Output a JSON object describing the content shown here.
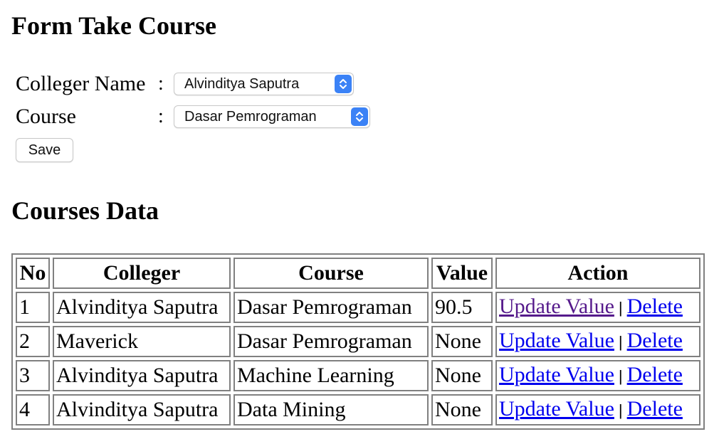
{
  "form": {
    "title": "Form Take Course",
    "colleger_label": "Colleger Name",
    "colleger_colon": ":",
    "colleger_value": "Alvinditya Saputra",
    "course_label": "Course",
    "course_colon": ":",
    "course_value": "Dasar Pemrograman",
    "save_label": "Save"
  },
  "courses": {
    "title": "Courses Data",
    "headers": [
      "No",
      "Colleger",
      "Course",
      "Value",
      "Action"
    ],
    "rows": [
      {
        "no": "1",
        "colleger": "Alvinditya Saputra",
        "course": "Dasar Pemrograman",
        "value": "90.5",
        "update": "Update Value",
        "sep": "|",
        "delete": "Delete"
      },
      {
        "no": "2",
        "colleger": "Maverick",
        "course": "Dasar Pemrograman",
        "value": "None",
        "update": "Update Value",
        "sep": "|",
        "delete": "Delete"
      },
      {
        "no": "3",
        "colleger": "Alvinditya Saputra",
        "course": "Machine Learning",
        "value": "None",
        "update": "Update Value",
        "sep": "|",
        "delete": "Delete"
      },
      {
        "no": "4",
        "colleger": "Alvinditya Saputra",
        "course": "Data Mining",
        "value": "None",
        "update": "Update Value",
        "sep": "|",
        "delete": "Delete"
      }
    ]
  },
  "colors": {
    "link": "#0000ee",
    "visited_link": "#551a8b",
    "select_arrow_bg": "#3b82f6"
  },
  "icons": {
    "select_arrow": "up-down-chevron-icon"
  }
}
